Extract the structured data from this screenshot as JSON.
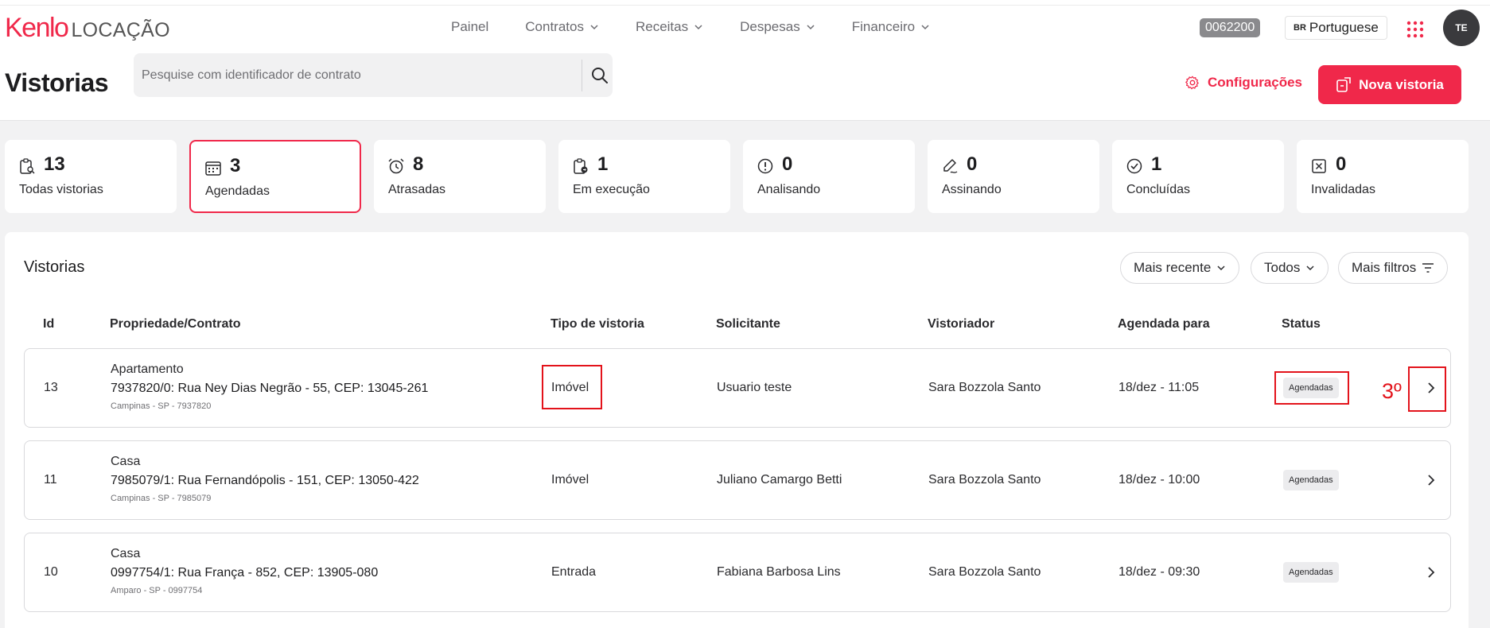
{
  "brand": {
    "name": "Kenlo",
    "product": "LOCAÇÃO",
    "color": "#f0284a"
  },
  "nav": {
    "items": [
      {
        "label": "Painel",
        "dropdown": false
      },
      {
        "label": "Contratos",
        "dropdown": true
      },
      {
        "label": "Receitas",
        "dropdown": true
      },
      {
        "label": "Despesas",
        "dropdown": true
      },
      {
        "label": "Financeiro",
        "dropdown": true
      }
    ]
  },
  "account": {
    "code": "0062200",
    "language_flag": "BR",
    "language": "Portuguese",
    "avatar_initials": "TE"
  },
  "page": {
    "title": "Vistorias",
    "search_placeholder": "Pesquise com identificador de contrato",
    "search_value": "",
    "config_label": "Configurações",
    "new_button_label": "Nova vistoria"
  },
  "status_cards": [
    {
      "count": "13",
      "label": "Todas vistorias",
      "icon": "clipboard-search-icon",
      "active": false
    },
    {
      "count": "3",
      "label": "Agendadas",
      "icon": "calendar-icon",
      "active": true
    },
    {
      "count": "8",
      "label": "Atrasadas",
      "icon": "alarm-clock-icon",
      "active": false
    },
    {
      "count": "1",
      "label": "Em execução",
      "icon": "clipboard-progress-icon",
      "active": false
    },
    {
      "count": "0",
      "label": "Analisando",
      "icon": "alert-circle-icon",
      "active": false
    },
    {
      "count": "0",
      "label": "Assinando",
      "icon": "pen-sign-icon",
      "active": false
    },
    {
      "count": "1",
      "label": "Concluídas",
      "icon": "check-circle-icon",
      "active": false
    },
    {
      "count": "0",
      "label": "Invalidadas",
      "icon": "x-square-icon",
      "active": false
    }
  ],
  "table": {
    "title": "Vistorias",
    "filters": {
      "sort_label": "Mais recente",
      "type_label": "Todos",
      "more_label": "Mais filtros"
    },
    "columns": [
      "Id",
      "Propriedade/Contrato",
      "Tipo de vistoria",
      "Solicitante",
      "Vistoriador",
      "Agendada para",
      "Status"
    ],
    "rows": [
      {
        "id": "13",
        "property_type": "Apartamento",
        "address": "7937820/0: Rua Ney Dias Negrão - 55, CEP: 13045-261",
        "city": "Campinas - SP - 7937820",
        "inspection_type": "Imóvel",
        "requester": "Usuario teste",
        "inspector": "Sara Bozzola Santo",
        "scheduled": "18/dez - 11:05",
        "status": "Agendadas"
      },
      {
        "id": "11",
        "property_type": "Casa",
        "address": "7985079/1: Rua Fernandópolis - 151, CEP: 13050-422",
        "city": "Campinas - SP - 7985079",
        "inspection_type": "Imóvel",
        "requester": "Juliano Camargo Betti",
        "inspector": "Sara Bozzola Santo",
        "scheduled": "18/dez - 10:00",
        "status": "Agendadas"
      },
      {
        "id": "10",
        "property_type": "Casa",
        "address": "0997754/1: Rua França - 852, CEP: 13905-080",
        "city": "Amparo - SP - 0997754",
        "inspection_type": "Entrada",
        "requester": "Fabiana Barbosa Lins",
        "inspector": "Sara Bozzola Santo",
        "scheduled": "18/dez - 09:30",
        "status": "Agendadas"
      }
    ]
  },
  "annotation": {
    "text": "3º",
    "color": "#e3131b"
  }
}
